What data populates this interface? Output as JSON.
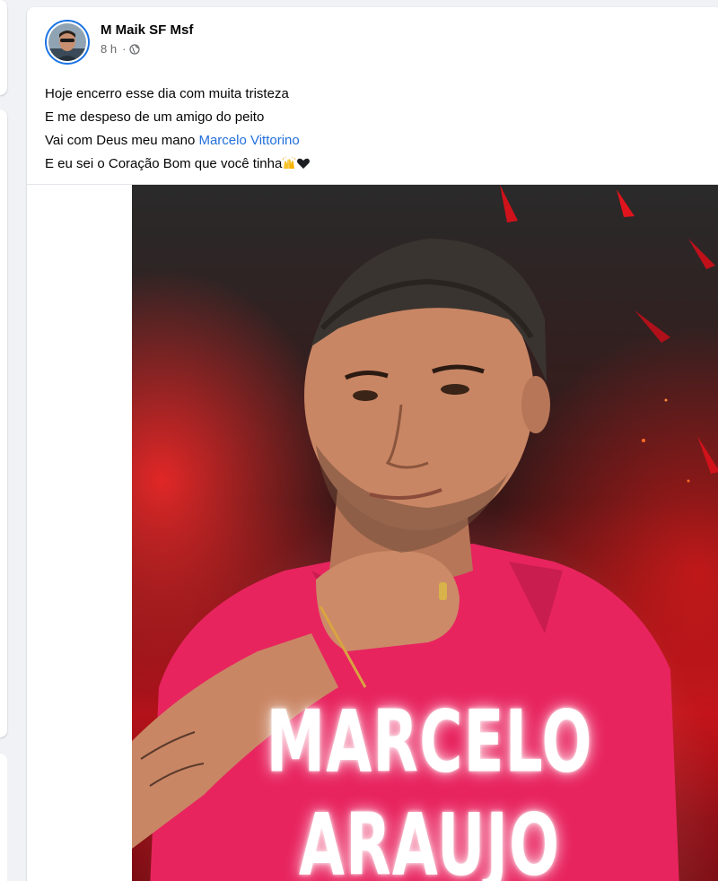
{
  "post": {
    "author": "M Maik SF Msf",
    "time": "8 h",
    "separator": "·",
    "privacy_icon": "globe-icon",
    "lines": [
      "Hoje encerro esse dia com muita tristeza",
      "E me despeso de um amigo do peito"
    ],
    "line3_prefix": "Vai com Deus meu mano ",
    "mention": "Marcelo Vittorino",
    "line4_text": "E eu sei o Coração Bom que você tinha",
    "emojis": [
      "raising-hands-emoji",
      "black-heart-emoji"
    ],
    "photo": {
      "overlay_line1": "MARCELO",
      "overlay_line2": "ARAUJO"
    }
  },
  "colors": {
    "mention": "#216fdb",
    "avatar_ring": "#1b74e4",
    "shirt": "#e8245f",
    "background_red": "#c4161c"
  }
}
